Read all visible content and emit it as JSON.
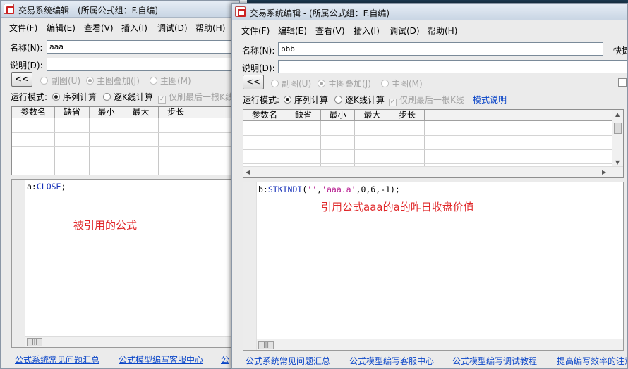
{
  "left_window": {
    "title": "交易系统编辑 - (所属公式组：F.自编)",
    "menu": [
      "文件(F)",
      "编辑(E)",
      "查看(V)",
      "插入(I)",
      "调试(D)",
      "帮助(H)"
    ],
    "name_label": "名称(N):",
    "name_value": "aaa",
    "desc_label": "说明(D):",
    "desc_value": "",
    "back_button": "<<",
    "chart_options": [
      "副图(U)",
      "主图叠加(J)",
      "主图(M)"
    ],
    "run_mode_label": "运行模式:",
    "run_modes": [
      "序列计算",
      "逐K线计算"
    ],
    "last_k_only": "仅刷最后一根K线",
    "param_columns": [
      "参数名",
      "缺省",
      "最小",
      "最大",
      "步长"
    ],
    "code_prefix": "a:",
    "code_fn": "CLOSE",
    "code_suffix": ";",
    "annotation": "被引用的公式",
    "footer_links": [
      "公式系统常见问题汇总",
      "公式模型编写客服中心",
      "公"
    ]
  },
  "right_window": {
    "title": "交易系统编辑 - (所属公式组：F.自编)",
    "menu": [
      "文件(F)",
      "编辑(E)",
      "查看(V)",
      "插入(I)",
      "调试(D)",
      "帮助(H)"
    ],
    "name_label": "名称(N):",
    "name_value": "bbb",
    "quick_label": "快捷",
    "desc_label": "说明(D):",
    "desc_value": "",
    "back_button": "<<",
    "chart_options": [
      "副图(U)",
      "主图叠加(J)",
      "主图(M)"
    ],
    "run_mode_label": "运行模式:",
    "run_modes": [
      "序列计算",
      "逐K线计算"
    ],
    "last_k_only": "仅刷最后一根K线",
    "mode_help_link": "模式说明",
    "param_columns": [
      "参数名",
      "缺省",
      "最小",
      "最大",
      "步长"
    ],
    "code_prefix": "b:",
    "code_fn": "STKINDI",
    "code_open": "(",
    "code_arg1": "''",
    "code_comma1": ",",
    "code_arg2": "'aaa.a'",
    "code_rest": ",0,6,-1);",
    "annotation": "引用公式aaa的a的昨日收盘价值",
    "footer_links": [
      "公式系统常见问题汇总",
      "公式模型编写客服中心",
      "公式模型编写调试教程",
      "提高编写效率的注意"
    ]
  }
}
